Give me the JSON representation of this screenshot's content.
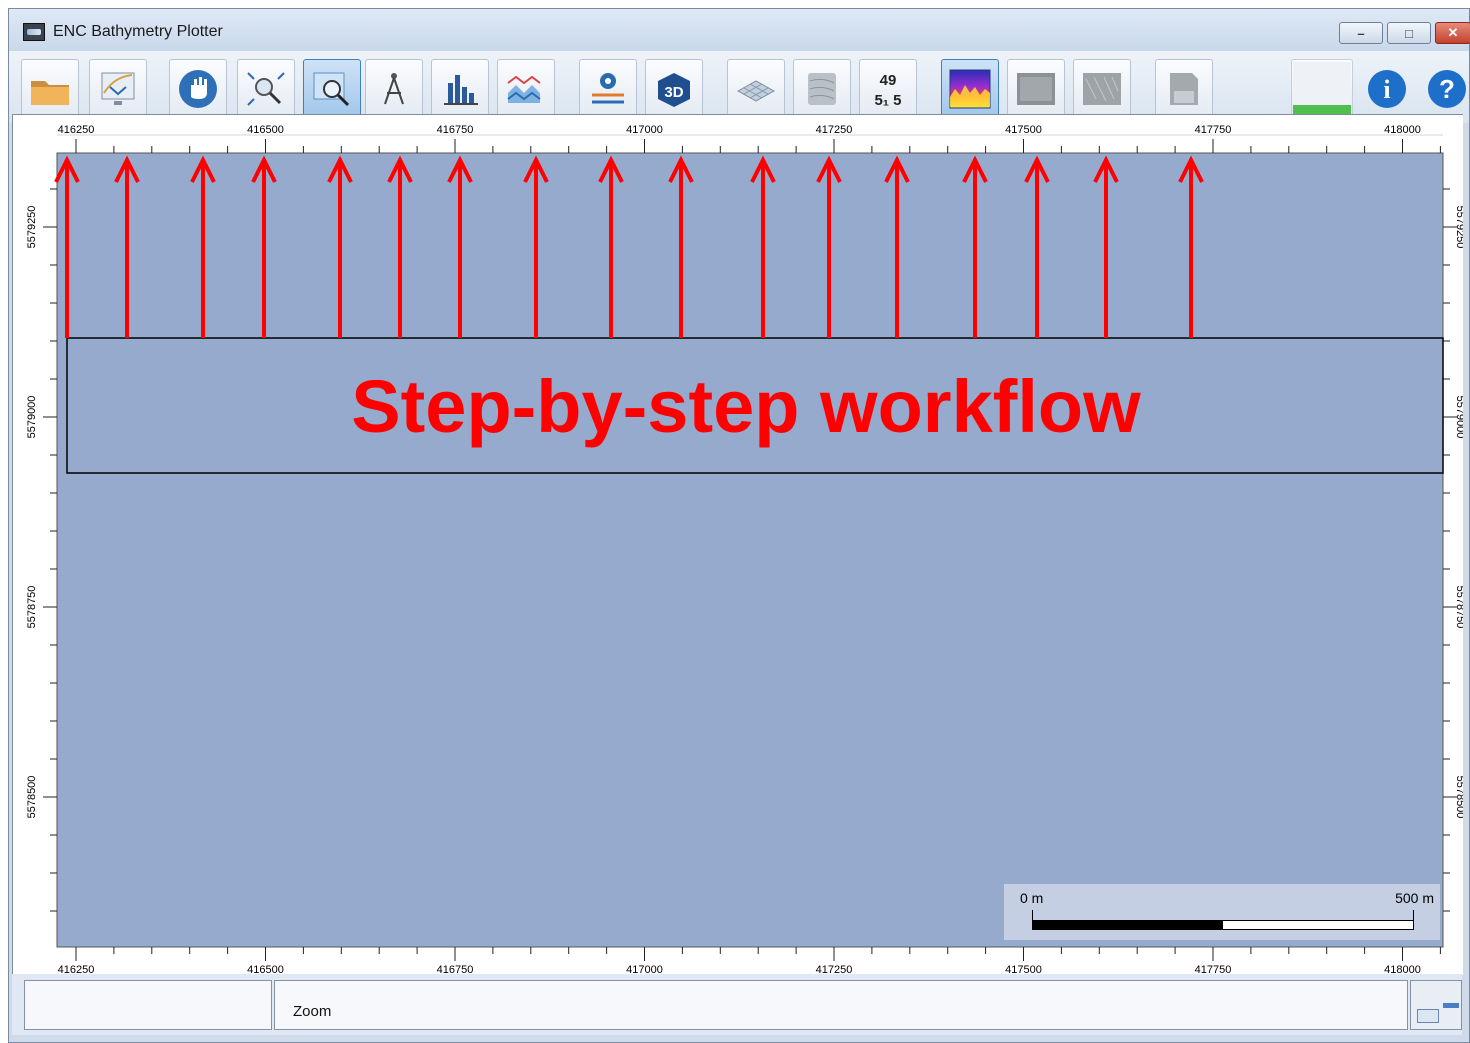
{
  "window": {
    "title": "ENC Bathymetry Plotter",
    "minimize_label": "–",
    "maximize_label": "□",
    "close_label": "✕"
  },
  "toolbar": {
    "buttons": [
      {
        "name": "open-folder-button",
        "icon": "folder-icon"
      },
      {
        "name": "import-chart-button",
        "icon": "chart-download-icon"
      },
      {
        "name": "pan-button",
        "icon": "hand-icon"
      },
      {
        "name": "zoom-extent-button",
        "icon": "magnify-extent-icon"
      },
      {
        "name": "zoom-button",
        "icon": "zoom-icon",
        "active": true
      },
      {
        "name": "measure-button",
        "icon": "compass-icon"
      },
      {
        "name": "histogram-button",
        "icon": "bar-chart-icon"
      },
      {
        "name": "profile-button",
        "icon": "profile-icon"
      },
      {
        "name": "settings-button",
        "icon": "gear-sliders-icon"
      },
      {
        "name": "view-3d-button",
        "icon": "3d-icon",
        "label": "3D"
      },
      {
        "name": "grid-surface-button",
        "icon": "grid-surface-icon"
      },
      {
        "name": "contours-button",
        "icon": "contours-icon"
      },
      {
        "name": "soundings-button",
        "icon": "soundings-icon",
        "label_top": "49",
        "label_bottom": "5₁ 5"
      },
      {
        "name": "color-depth-button",
        "icon": "color-depth-icon"
      },
      {
        "name": "shaded-relief-button",
        "icon": "shaded-relief-icon"
      },
      {
        "name": "texture-button",
        "icon": "texture-icon"
      },
      {
        "name": "save-button",
        "icon": "disk-icon"
      },
      {
        "name": "progress-indicator",
        "icon": "progress-icon"
      },
      {
        "name": "info-button",
        "icon": "info-icon",
        "label": "i"
      },
      {
        "name": "help-button",
        "icon": "help-icon",
        "label": "?"
      }
    ]
  },
  "map": {
    "x_ticks": [
      "416250",
      "416500",
      "416750",
      "417000",
      "417250",
      "417500",
      "417750",
      "418000"
    ],
    "y_ticks": [
      "5579250",
      "5579000",
      "5578750",
      "5578500"
    ],
    "background_color": "#96aacd",
    "scale_bar": {
      "left_label": "0 m",
      "right_label": "500 m"
    }
  },
  "annotation": {
    "text": "Step-by-step workflow",
    "color": "#ff0000"
  },
  "statusbar": {
    "pane1": "",
    "pane2": "Zoom"
  }
}
